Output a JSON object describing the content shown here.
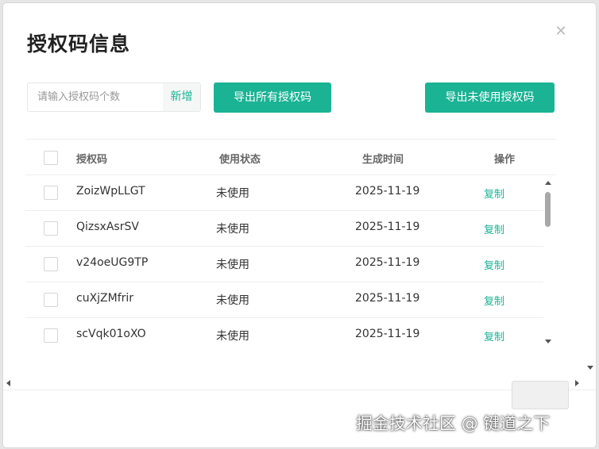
{
  "modal": {
    "title": "授权码信息",
    "close_icon": "close-icon"
  },
  "toolbar": {
    "count_placeholder": "请输入授权码个数",
    "count_value": "",
    "add_label": "新增",
    "export_all_label": "导出所有授权码",
    "export_unused_label": "导出未使用授权码"
  },
  "table": {
    "headers": {
      "code": "授权码",
      "status": "使用状态",
      "time": "生成时间",
      "action": "操作"
    },
    "rows": [
      {
        "code": "ZoizWpLLGT",
        "status": "未使用",
        "time": "2025-11-19",
        "action": "复制"
      },
      {
        "code": "QizsxAsrSV",
        "status": "未使用",
        "time": "2025-11-19",
        "action": "复制"
      },
      {
        "code": "v24oeUG9TP",
        "status": "未使用",
        "time": "2025-11-19",
        "action": "复制"
      },
      {
        "code": "cuXjZMfrir",
        "status": "未使用",
        "time": "2025-11-19",
        "action": "复制"
      },
      {
        "code": "scVqk01oXO",
        "status": "未使用",
        "time": "2025-11-19",
        "action": "复制"
      }
    ]
  },
  "colors": {
    "accent": "#1ab394"
  },
  "watermark": "掘金技术社区 @ 键道之下"
}
